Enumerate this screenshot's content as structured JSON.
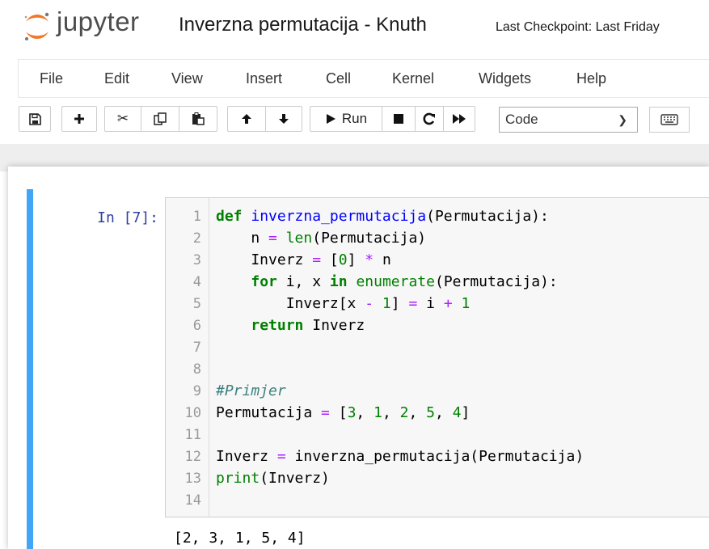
{
  "header": {
    "brand": "jupyter",
    "notebook_title": "Inverzna permutacija - Knuth",
    "checkpoint": "Last Checkpoint: Last Friday"
  },
  "menu": [
    "File",
    "Edit",
    "View",
    "Insert",
    "Cell",
    "Kernel",
    "Widgets",
    "Help"
  ],
  "toolbar": {
    "run_label": "Run",
    "cell_type": "Code",
    "icons": [
      "save-icon",
      "plus-icon",
      "scissors-icon",
      "copy-icon",
      "paste-icon",
      "arrow-up-icon",
      "arrow-down-icon",
      "play-icon",
      "stop-icon",
      "restart-icon",
      "fast-forward-icon",
      "keyboard-icon"
    ]
  },
  "cell": {
    "prompt": "In [7]:",
    "line_numbers": [
      "1",
      "2",
      "3",
      "4",
      "5",
      "6",
      "7",
      "8",
      "9",
      "10",
      "11",
      "12",
      "13",
      "14"
    ],
    "output": "[2, 3, 1, 5, 4]"
  },
  "colors": {
    "cell_selected_bar": "#42a5f5",
    "prompt": "#303f9f",
    "keyword": "#008000",
    "function_name": "#0000ff",
    "operator": "#aa22ff",
    "comment": "#408080"
  }
}
